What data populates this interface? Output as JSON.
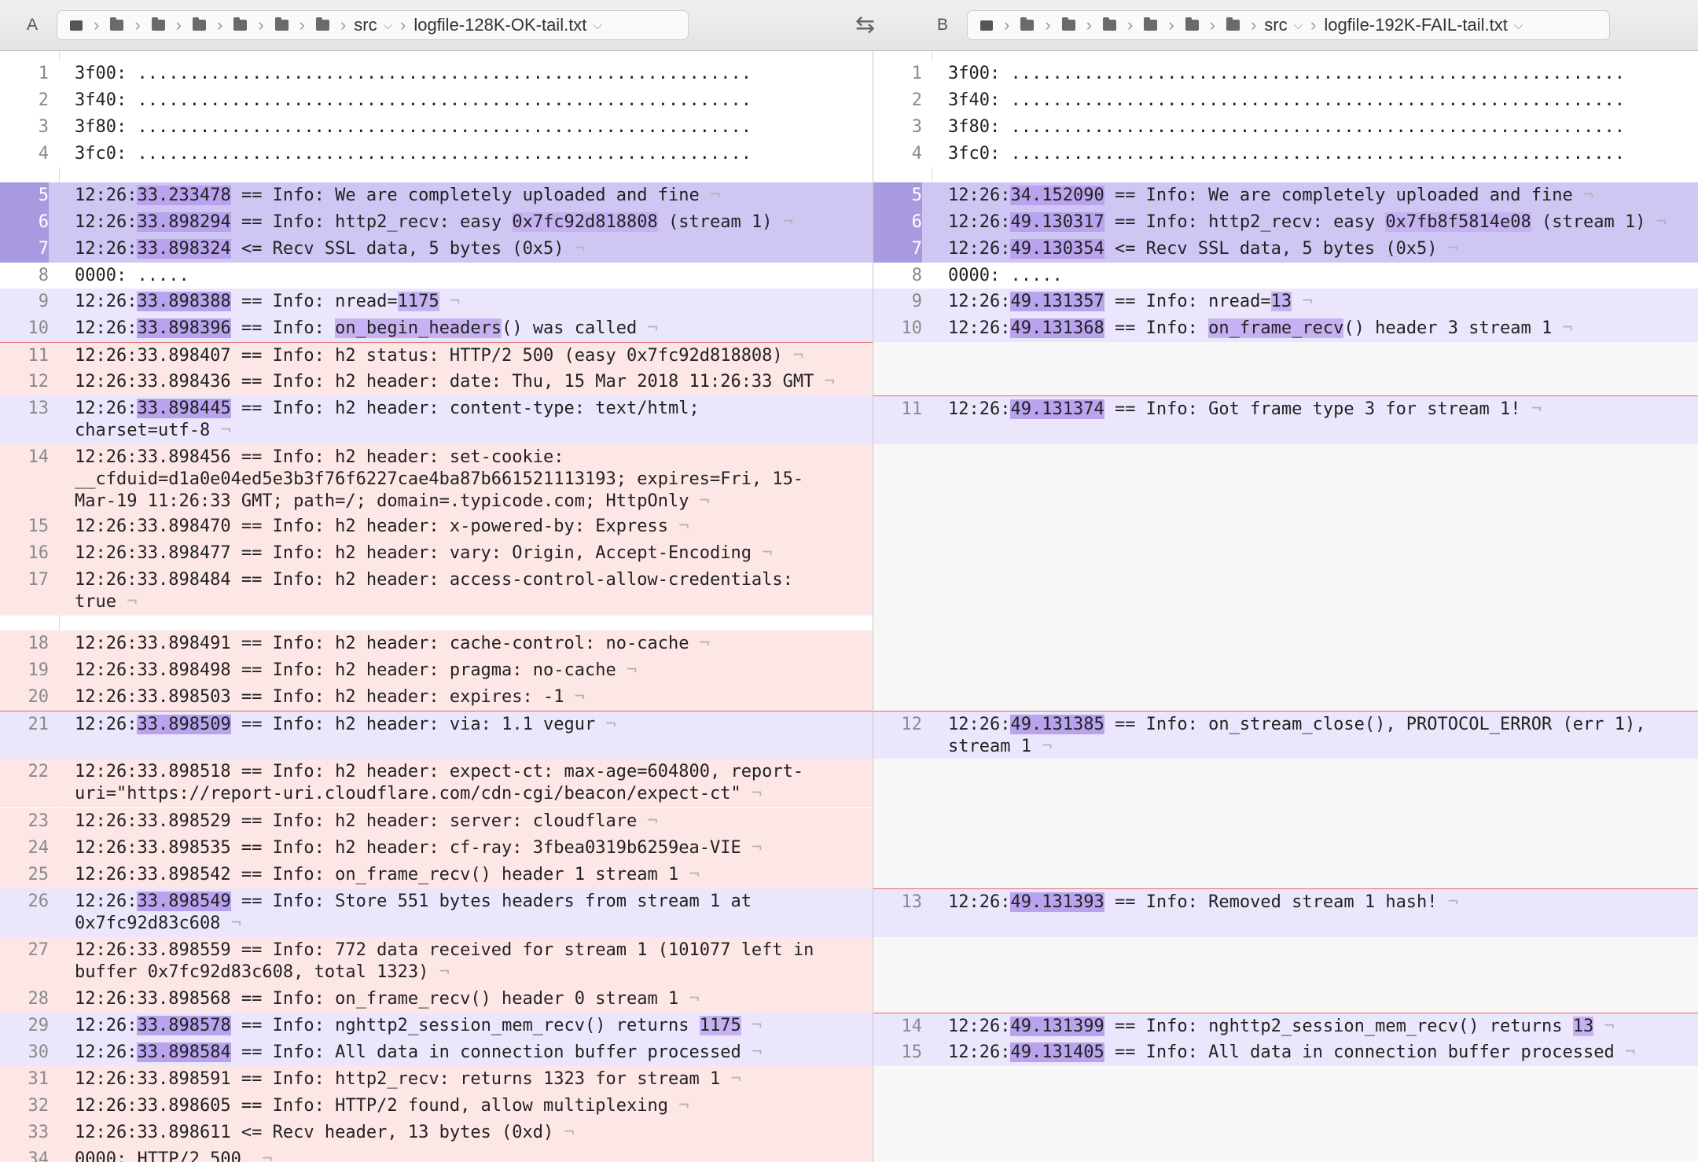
{
  "toolbar": {
    "left_letter": "A",
    "right_letter": "B",
    "left_path": [
      "src",
      "logfile-128K-OK-tail.txt"
    ],
    "right_path": [
      "src",
      "logfile-192K-FAIL-tail.txt"
    ],
    "swap_icon": "swap-panes-icon"
  },
  "colors": {
    "changed_line": "#cfc6f4",
    "changed_gutter": "#a99ae0",
    "removed_line": "#fde6e6",
    "separator": "#e36b6b"
  },
  "paneA": {
    "lines": [
      {
        "n": "1",
        "t": "3f00: ..........................................................."
      },
      {
        "n": "2",
        "t": "3f40: ..........................................................."
      },
      {
        "n": "3",
        "t": "3f80: ..........................................................."
      },
      {
        "n": "4",
        "t": "3fc0: ..........................................................."
      },
      {
        "n": "5",
        "p": "12:26:",
        "h": "33.233478",
        "s": " == Info: We are completely uploaded and fine"
      },
      {
        "n": "6",
        "p": "12:26:",
        "h": "33.898294",
        "s": " == Info: http2_recv: easy ",
        "h2": "0x7fc92d818808",
        "s2": " (stream 1)"
      },
      {
        "n": "7",
        "p": "12:26:",
        "h": "33.898324",
        "s": " <= Recv SSL data, 5 bytes (0x5)"
      },
      {
        "n": "8",
        "t": "0000: ....."
      },
      {
        "n": "9",
        "p": "12:26:",
        "h": "33.898388",
        "s": " == Info: nread=",
        "h2": "1175"
      },
      {
        "n": "10",
        "p": "12:26:",
        "h": "33.898396",
        "s": " == Info: ",
        "h2": "on_begin_headers",
        "s2": "() was called"
      },
      {
        "n": "11",
        "t": "12:26:33.898407 == Info: h2 status: HTTP/2 500 (easy 0x7fc92d818808)"
      },
      {
        "n": "12",
        "t": "12:26:33.898436 == Info: h2 header: date: Thu, 15 Mar 2018 11:26:33 GMT"
      },
      {
        "n": "13",
        "p": "12:26:",
        "h": "33.898445",
        "s": " == Info: h2 header: content-type: text/html;\ncharset=utf-8"
      },
      {
        "n": "14",
        "t": "12:26:33.898456 == Info: h2 header: set-cookie:\n__cfduid=d1a0e04ed5e3b3f76f6227cae4ba87b661521113193; expires=Fri, 15-\nMar-19 11:26:33 GMT; path=/; domain=.typicode.com; HttpOnly"
      },
      {
        "n": "15",
        "t": "12:26:33.898470 == Info: h2 header: x-powered-by: Express"
      },
      {
        "n": "16",
        "t": "12:26:33.898477 == Info: h2 header: vary: Origin, Accept-Encoding"
      },
      {
        "n": "17",
        "t": "12:26:33.898484 == Info: h2 header: access-control-allow-credentials:\ntrue"
      },
      {
        "n": "18",
        "t": "12:26:33.898491 == Info: h2 header: cache-control: no-cache"
      },
      {
        "n": "19",
        "t": "12:26:33.898498 == Info: h2 header: pragma: no-cache"
      },
      {
        "n": "20",
        "t": "12:26:33.898503 == Info: h2 header: expires: -1"
      },
      {
        "n": "21",
        "p": "12:26:",
        "h": "33.898509",
        "s": " == Info: h2 header: via: 1.1 vegur"
      },
      {
        "n": "22",
        "t": "12:26:33.898518 == Info: h2 header: expect-ct: max-age=604800, report-\nuri=\"https://report-uri.cloudflare.com/cdn-cgi/beacon/expect-ct\""
      },
      {
        "n": "23",
        "t": "12:26:33.898529 == Info: h2 header: server: cloudflare"
      },
      {
        "n": "24",
        "t": "12:26:33.898535 == Info: h2 header: cf-ray: 3fbea0319b6259ea-VIE"
      },
      {
        "n": "25",
        "t": "12:26:33.898542 == Info: on_frame_recv() header 1 stream 1"
      },
      {
        "n": "26",
        "p": "12:26:",
        "h": "33.898549",
        "s": " == Info: Store 551 bytes headers from stream 1 at\n0x7fc92d83c608"
      },
      {
        "n": "27",
        "t": "12:26:33.898559 == Info: 772 data received for stream 1 (101077 left in\nbuffer 0x7fc92d83c608, total 1323)"
      },
      {
        "n": "28",
        "t": "12:26:33.898568 == Info: on_frame_recv() header 0 stream 1"
      },
      {
        "n": "29",
        "p": "12:26:",
        "h": "33.898578",
        "s": " == Info: nghttp2_session_mem_recv() returns ",
        "h2": "1175"
      },
      {
        "n": "30",
        "p": "12:26:",
        "h": "33.898584",
        "s": " == Info: All data in connection buffer processed"
      },
      {
        "n": "31",
        "t": "12:26:33.898591 == Info: http2_recv: returns 1323 for stream 1"
      },
      {
        "n": "32",
        "t": "12:26:33.898605 == Info: HTTP/2 found, allow multiplexing"
      },
      {
        "n": "33",
        "t": "12:26:33.898611 <= Recv header, 13 bytes (0xd)"
      },
      {
        "n": "34",
        "t": "0000: HTTP/2 500 "
      }
    ]
  },
  "paneB": {
    "lines": [
      {
        "n": "1",
        "t": "3f00: ..........................................................."
      },
      {
        "n": "2",
        "t": "3f40: ..........................................................."
      },
      {
        "n": "3",
        "t": "3f80: ..........................................................."
      },
      {
        "n": "4",
        "t": "3fc0: ..........................................................."
      },
      {
        "n": "5",
        "p": "12:26:",
        "h": "34.152090",
        "s": " == Info: We are completely uploaded and fine"
      },
      {
        "n": "6",
        "p": "12:26:",
        "h": "49.130317",
        "s": " == Info: http2_recv: easy ",
        "h2": "0x7fb8f5814e08",
        "s2": " (stream 1)"
      },
      {
        "n": "7",
        "p": "12:26:",
        "h": "49.130354",
        "s": " <= Recv SSL data, 5 bytes (0x5)"
      },
      {
        "n": "8",
        "t": "0000: ....."
      },
      {
        "n": "9",
        "p": "12:26:",
        "h": "49.131357",
        "s": " == Info: nread=",
        "h2": "13"
      },
      {
        "n": "10",
        "p": "12:26:",
        "h": "49.131368",
        "s": " == Info: ",
        "h2": "on_frame_recv",
        "s2": "() header 3 stream 1"
      },
      {
        "n": "11",
        "p": "12:26:",
        "h": "49.131374",
        "s": " == Info: Got frame type 3 for stream 1!"
      },
      {
        "n": "12",
        "p": "12:26:",
        "h": "49.131385",
        "s": " == Info: on_stream_close(), PROTOCOL_ERROR (err 1),\nstream 1"
      },
      {
        "n": "13",
        "p": "12:26:",
        "h": "49.131393",
        "s": " == Info: Removed stream 1 hash!"
      },
      {
        "n": "14",
        "p": "12:26:",
        "h": "49.131399",
        "s": " == Info: nghttp2_session_mem_recv() returns ",
        "h2": "13"
      },
      {
        "n": "15",
        "p": "12:26:",
        "h": "49.131405",
        "s": " == Info: All data in connection buffer processed"
      }
    ]
  }
}
